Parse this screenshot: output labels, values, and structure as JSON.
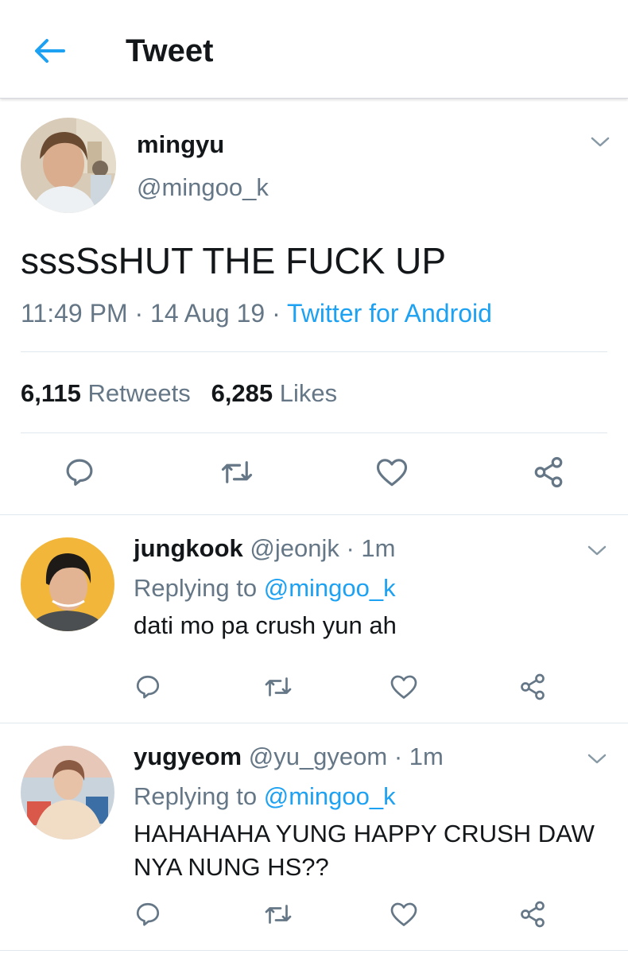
{
  "header": {
    "title": "Tweet"
  },
  "main_tweet": {
    "display_name": "mingyu",
    "handle": "@mingoo_k",
    "text": "sssSsHUT THE FUCK UP",
    "time": "11:49 PM",
    "date": "14 Aug 19",
    "separator": "·",
    "source": "Twitter for Android",
    "retweets_count": "6,115",
    "retweets_label": "Retweets",
    "likes_count": "6,285",
    "likes_label": "Likes"
  },
  "replies": [
    {
      "display_name": "jungkook",
      "handle": "@jeonjk",
      "age": "· 1m",
      "replying_prefix": "Replying to",
      "replying_to": "@mingoo_k",
      "text": "dati mo pa crush yun ah"
    },
    {
      "display_name": "yugyeom",
      "handle": "@yu_gyeom",
      "age": "· 1m",
      "replying_prefix": "Replying to",
      "replying_to": "@mingoo_k",
      "text": "HAHAHAHA YUNG HAPPY CRUSH DAW NYA NUNG HS??"
    }
  ],
  "icons": {
    "back": "back-arrow-icon",
    "caret": "chevron-down-icon",
    "reply": "reply-icon",
    "retweet": "retweet-icon",
    "like": "heart-icon",
    "share": "share-icon"
  },
  "colors": {
    "accent": "#1da1f2",
    "text_primary": "#14171a",
    "text_secondary": "#657786",
    "divider": "#e1e8ed"
  }
}
